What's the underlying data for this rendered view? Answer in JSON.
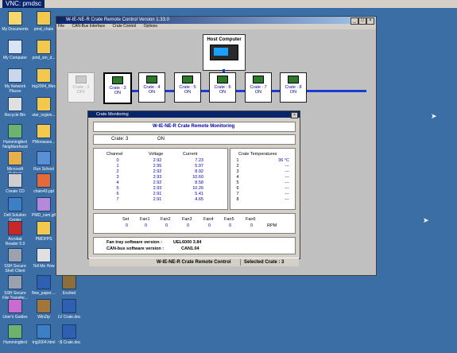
{
  "vnc_title": "VNC: pmdsc",
  "desktop_icons": [
    {
      "label": "My Documents"
    },
    {
      "label": "pmd_chain"
    },
    {
      "label": "My Computer"
    },
    {
      "label": "pmd_sm_d..."
    },
    {
      "label": "My Network Places"
    },
    {
      "label": "trig2004_files"
    },
    {
      "label": "Recycle Bin"
    },
    {
      "label": "star_region..."
    },
    {
      "label": "Hummingbird Neighborhood"
    },
    {
      "label": "PMonwave..."
    },
    {
      "label": "Microsoft Outlook"
    },
    {
      "label": "Run School"
    },
    {
      "label": "Create CD"
    },
    {
      "label": "chain43.ppt"
    },
    {
      "label": "Dell Solution Center"
    },
    {
      "label": "PMD_cam.gif"
    },
    {
      "label": "Acrobat Reader 5.0"
    },
    {
      "label": "PMDFPS"
    },
    {
      "label": "SSH Secure Shell Client"
    },
    {
      "label": "Tell Me How"
    },
    {
      "label": "SSH Secure File Transfer..."
    },
    {
      "label": "flow_paper...."
    },
    {
      "label": "Excited"
    },
    {
      "label": "User's Guides"
    },
    {
      "label": "WinZip"
    },
    {
      "label": "LV Crate.doc"
    },
    {
      "label": "Hummingbird"
    },
    {
      "label": "trig2004.html"
    },
    {
      "label": "~$ Crate.doc"
    }
  ],
  "app": {
    "title": "W-IE-NE-R Crate Remote Control Version 1.33.0",
    "menu": [
      "File",
      "CAN-Bus Interface",
      "Crate Control",
      "Options"
    ],
    "host_label": "Host Computer",
    "crates": [
      {
        "label": "Crate : 2",
        "state": "OFF"
      },
      {
        "label": "Crate : 3",
        "state": "ON"
      },
      {
        "label": "Crate : 4",
        "state": "ON"
      },
      {
        "label": "Crate : 5",
        "state": "ON"
      },
      {
        "label": "Crate : 6",
        "state": "ON"
      },
      {
        "label": "Crate : 7",
        "state": "ON"
      },
      {
        "label": "Crate : 8",
        "state": "ON"
      }
    ],
    "status_left": "W-IE-NE-R Crate Remote Control",
    "status_right": "Selected Crate : 3"
  },
  "monitor": {
    "title": "Crate Monitoring",
    "heading": "W-IE-NE-R Crate Remote Monitoring",
    "crate_label": "Crate: 3",
    "crate_state": "ON",
    "col_channel": "Channel",
    "col_voltage": "Voltage",
    "col_current": "Current",
    "channels": [
      "0",
      "1",
      "2",
      "3",
      "4",
      "5",
      "6",
      "7"
    ],
    "voltages": [
      "2.92",
      "2.95",
      "2.92",
      "2.93",
      "2.92",
      "2.93",
      "2.91",
      "2.91"
    ],
    "currents": [
      "7.23",
      "5.97",
      "8.92",
      "10.60",
      "8.58",
      "10.26",
      "5.41",
      "4.65"
    ],
    "temp_title": "Crate Temperatures",
    "temp_idx": [
      "1",
      "2",
      "3",
      "4",
      "5",
      "6",
      "7",
      "8"
    ],
    "temp_vals": [
      "36 °C",
      "---",
      "---",
      "---",
      "---",
      "---",
      "---",
      "---"
    ],
    "fan_headers": [
      "Set",
      "Fan1",
      "Fan2",
      "Fan3",
      "Fan4",
      "Fan5",
      "Fan6"
    ],
    "fan_values": [
      "0",
      "0",
      "0",
      "0",
      "0",
      "0",
      "0"
    ],
    "fan_unit": "RPM",
    "fan_sw_label": "Fan tray software version :",
    "fan_sw_value": "UEL6000 3.84",
    "can_sw_label": "CAN-bus software version :",
    "can_sw_value": "CAN1.04"
  }
}
